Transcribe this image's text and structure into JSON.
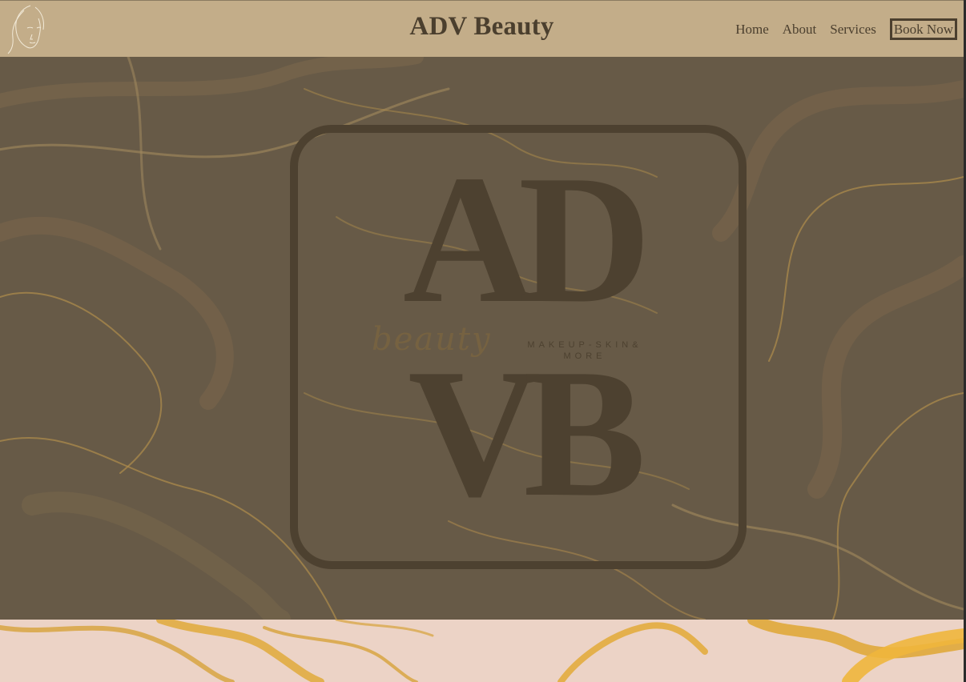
{
  "header": {
    "brand": "ADV Beauty",
    "logo_icon": "face-line-art-icon",
    "nav": {
      "home": "Home",
      "about": "About",
      "services": "Services",
      "book_now": "Book Now"
    }
  },
  "hero": {
    "monogram_top": "AD",
    "monogram_bottom": "VB",
    "script_word": "beauty",
    "tagline_line1": "MAKEUP-SKIN&",
    "tagline_line2": "MORE"
  },
  "colors": {
    "header_bg": "#c3ad89",
    "text_dark": "#4b3f2e",
    "hero_overlay": "#675a47",
    "gold_accent": "#c9962e",
    "blush": "#ecd3c6"
  }
}
